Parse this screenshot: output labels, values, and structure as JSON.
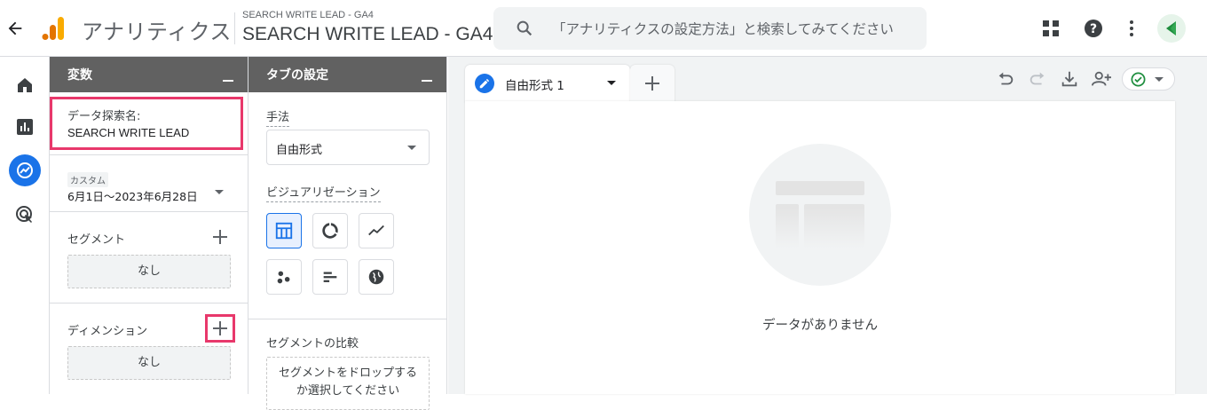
{
  "header": {
    "app_name": "アナリティクス",
    "account_path": "SEARCH WRITE LEAD - GA4",
    "property_name": "SEARCH WRITE LEAD - GA4",
    "search_placeholder": "「アナリティクスの設定方法」と検索してみてください",
    "icons": [
      "back-arrow-icon",
      "analytics-logo",
      "search-icon",
      "apps-grid-icon",
      "help-icon",
      "more-vert-icon",
      "account-avatar"
    ],
    "colors": {
      "logo_orange": "#f9ab00",
      "logo_dark": "#e37400",
      "avatar_green": "#34a853"
    }
  },
  "left_nav": {
    "items": [
      "home-icon",
      "reports-icon",
      "explore-icon",
      "advertising-icon"
    ],
    "active": "explore-icon",
    "accent": "#1a73e8"
  },
  "variables_panel": {
    "title": "変数",
    "exploration_name_label": "データ探索名:",
    "exploration_name_value": "SEARCH WRITE LEAD",
    "date_chip": "カスタム",
    "date_range": "6月1日～2023年6月28日",
    "segments_label": "セグメント",
    "segments_empty": "なし",
    "dimensions_label": "ディメンション",
    "dimensions_empty": "なし",
    "highlight_color": "#e8386b"
  },
  "tab_settings_panel": {
    "title": "タブの設定",
    "technique_label": "手法",
    "technique_value": "自由形式",
    "visualization_label": "ビジュアリゼーション",
    "visualizations": [
      "table-icon",
      "donut-chart-icon",
      "line-chart-icon",
      "scatter-plot-icon",
      "bar-chart-icon",
      "geo-map-icon"
    ],
    "selected_visualization": "table-icon",
    "segment_compare_label": "セグメントの比較",
    "segment_drop_text_1": "セグメントをドロップする",
    "segment_drop_text_2": "か選択してください"
  },
  "canvas": {
    "tab_name": "自由形式 1",
    "empty_message": "データがありません",
    "toolbar": [
      "undo-icon",
      "redo-icon",
      "download-icon",
      "share-user-icon",
      "status-check-icon"
    ]
  }
}
